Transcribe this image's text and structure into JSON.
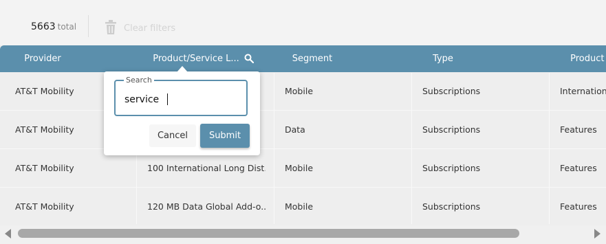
{
  "summary": {
    "total_count": "5663",
    "total_label": "total",
    "clear_filters_label": "Clear filters",
    "clear_icon": "trash-icon"
  },
  "table": {
    "columns": [
      {
        "label": "Provider"
      },
      {
        "label": "Product/Service L...",
        "icon": "search-icon"
      },
      {
        "label": "Segment"
      },
      {
        "label": "Type"
      },
      {
        "label": "Product g"
      }
    ],
    "rows": [
      [
        "AT&T Mobility",
        "",
        "Mobile",
        "Subscriptions",
        "Internation"
      ],
      [
        "AT&T Mobility",
        "",
        "Data",
        "Subscriptions",
        "Features"
      ],
      [
        "AT&T Mobility",
        "100 International Long Dist...",
        "Mobile",
        "Subscriptions",
        "Features"
      ],
      [
        "AT&T Mobility",
        "120 MB Data Global Add-o...",
        "Mobile",
        "Subscriptions",
        "Features"
      ]
    ]
  },
  "search_popup": {
    "legend": "Search",
    "value": "service",
    "cancel_label": "Cancel",
    "submit_label": "Submit"
  },
  "scrollbar": {
    "left_icon": "scroll-left-arrow-icon",
    "right_icon": "scroll-right-arrow-icon"
  },
  "colors": {
    "header_bg": "#5b8fac",
    "accent": "#5b8fac",
    "row_bg": "#eeeeee",
    "page_bg": "#f3f3f3"
  }
}
